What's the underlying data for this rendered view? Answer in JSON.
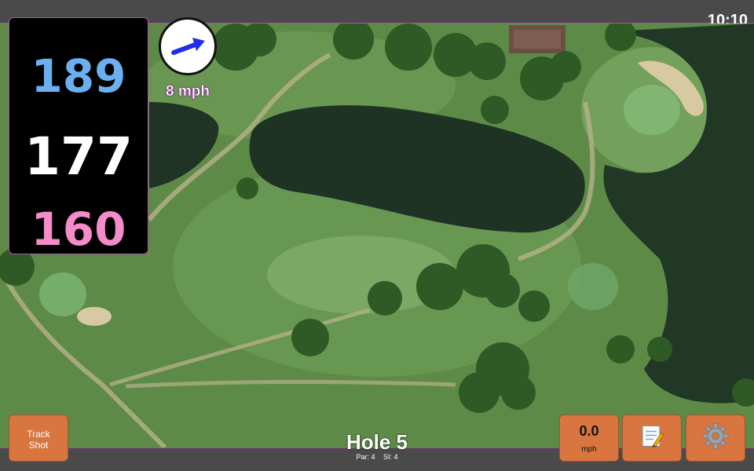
{
  "status": {
    "time": "10:10"
  },
  "distances": {
    "back": "189",
    "middle": "177",
    "front": "160"
  },
  "wind": {
    "speed_label": "8 mph",
    "arrow_icon": "wind-direction-arrow-icon"
  },
  "track_shot": {
    "line1": "Track",
    "line2": "Shot"
  },
  "hole": {
    "title": "Hole 5",
    "par": "Par: 4",
    "si": "SI: 4"
  },
  "speed": {
    "value": "0.0",
    "unit": "mph"
  },
  "icons": {
    "notes": "notepad-icon",
    "settings": "gear-icon"
  },
  "colors": {
    "back": "#6aaff0",
    "middle": "#ffffff",
    "front": "#f58bc8",
    "button": "#d97640",
    "accent": "#b04fb0"
  }
}
